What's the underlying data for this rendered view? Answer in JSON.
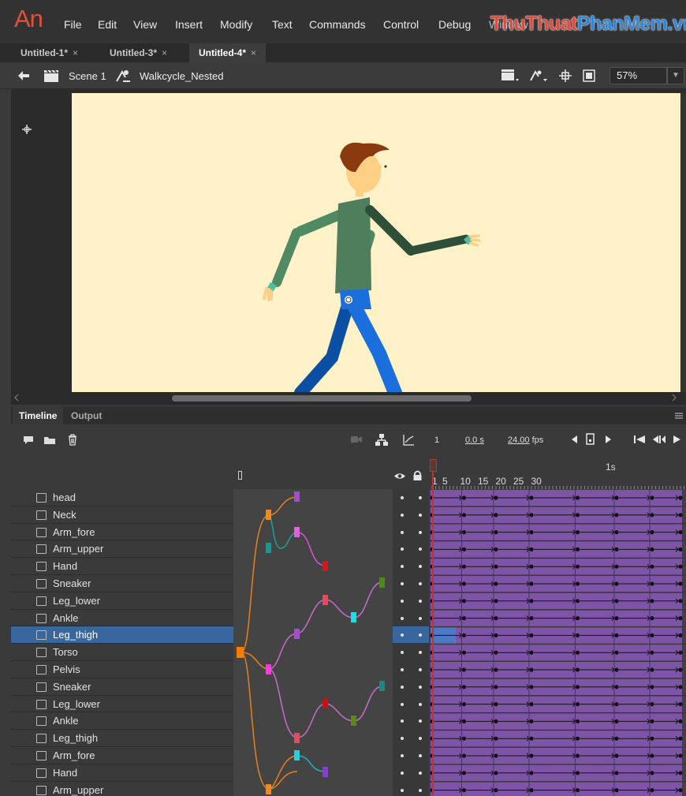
{
  "app": {
    "logo": "An",
    "menus": [
      "File",
      "Edit",
      "View",
      "Insert",
      "Modify",
      "Text",
      "Commands",
      "Control",
      "Debug",
      "Window"
    ],
    "watermark_a": "ThuThuat",
    "watermark_b": "PhanMem.vn"
  },
  "tabs": [
    {
      "label": "Untitled-1*",
      "close": "×",
      "active": false
    },
    {
      "label": "Untitled-3*",
      "close": "×",
      "active": false
    },
    {
      "label": "Untitled-4*",
      "close": "×",
      "active": true
    }
  ],
  "editbar": {
    "scene": "Scene 1",
    "symbol": "Walkcycle_Nested",
    "zoom": "57%"
  },
  "timeline": {
    "tab_timeline": "Timeline",
    "tab_output": "Output",
    "current_frame": "1",
    "time": "0.0",
    "time_unit": "s",
    "fps": "24.00",
    "fps_unit": "fps",
    "seconds_marker": "1s",
    "ruler_labels": [
      "1",
      "5",
      "10",
      "15",
      "20",
      "25",
      "30"
    ],
    "keyframes": [
      1,
      10,
      19,
      29,
      42,
      53,
      63,
      71
    ],
    "span_end_frame": 71,
    "layers": [
      {
        "name": "head",
        "selected": false
      },
      {
        "name": "Neck",
        "selected": false
      },
      {
        "name": "Arm_fore",
        "selected": false
      },
      {
        "name": "Arm_upper",
        "selected": false
      },
      {
        "name": "Hand",
        "selected": false
      },
      {
        "name": "Sneaker",
        "selected": false
      },
      {
        "name": "Leg_lower",
        "selected": false
      },
      {
        "name": "Ankle",
        "selected": false
      },
      {
        "name": "Leg_thigh",
        "selected": true
      },
      {
        "name": "Torso",
        "selected": false
      },
      {
        "name": "Pelvis",
        "selected": false
      },
      {
        "name": "Sneaker",
        "selected": false
      },
      {
        "name": "Leg_lower",
        "selected": false
      },
      {
        "name": "Ankle",
        "selected": false
      },
      {
        "name": "Leg_thigh",
        "selected": false
      },
      {
        "name": "Arm_fore",
        "selected": false
      },
      {
        "name": "Hand",
        "selected": false
      },
      {
        "name": "Arm_upper",
        "selected": false
      }
    ]
  },
  "colors": {
    "accent": "#e34f37",
    "selection": "#38669e",
    "frames": "#7e55a6",
    "stage": "#fff2c9",
    "playhead": "#c0332b"
  }
}
